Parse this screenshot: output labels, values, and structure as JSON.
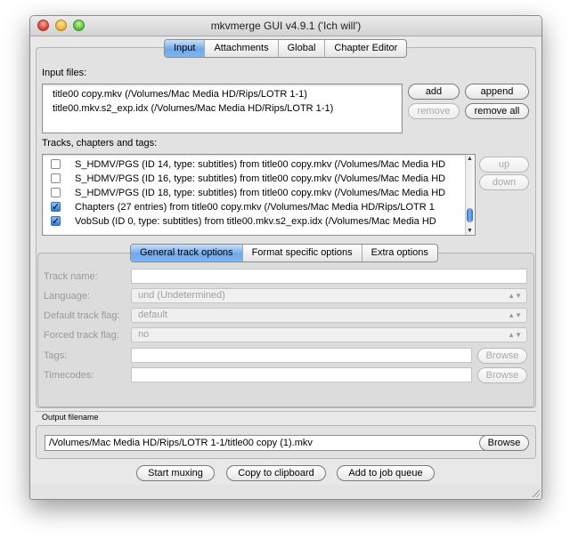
{
  "window": {
    "title": "mkvmerge GUI v4.9.1 ('Ich will')"
  },
  "main_tabs": [
    {
      "label": "Input",
      "active": true
    },
    {
      "label": "Attachments",
      "active": false
    },
    {
      "label": "Global",
      "active": false
    },
    {
      "label": "Chapter Editor",
      "active": false
    }
  ],
  "input": {
    "files_label": "Input files:",
    "files": [
      "title00 copy.mkv (/Volumes/Mac Media HD/Rips/LOTR 1-1)",
      "title00.mkv.s2_exp.idx (/Volumes/Mac Media HD/Rips/LOTR 1-1)"
    ],
    "buttons": {
      "add": "add",
      "append": "append",
      "remove": "remove",
      "remove_all": "remove all"
    }
  },
  "tracks": {
    "label": "Tracks, chapters and tags:",
    "items": [
      {
        "text": "S_HDMV/PGS (ID 14, type: subtitles) from title00 copy.mkv (/Volumes/Mac Media HD",
        "checked": false
      },
      {
        "text": "S_HDMV/PGS (ID 16, type: subtitles) from title00 copy.mkv (/Volumes/Mac Media HD",
        "checked": false
      },
      {
        "text": "S_HDMV/PGS (ID 18, type: subtitles) from title00 copy.mkv (/Volumes/Mac Media HD",
        "checked": false
      },
      {
        "text": "Chapters (27 entries) from title00 copy.mkv (/Volumes/Mac Media HD/Rips/LOTR 1",
        "checked": true
      },
      {
        "text": "VobSub (ID 0, type: subtitles) from title00.mkv.s2_exp.idx (/Volumes/Mac Media HD",
        "checked": true
      }
    ],
    "buttons": {
      "up": "up",
      "down": "down"
    }
  },
  "options_tabs": [
    {
      "label": "General track options",
      "active": true
    },
    {
      "label": "Format specific options",
      "active": false
    },
    {
      "label": "Extra options",
      "active": false
    }
  ],
  "options": {
    "track_name_label": "Track name:",
    "track_name_value": "",
    "language_label": "Language:",
    "language_value": "und (Undetermined)",
    "default_flag_label": "Default track flag:",
    "default_flag_value": "default",
    "forced_flag_label": "Forced track flag:",
    "forced_flag_value": "no",
    "tags_label": "Tags:",
    "timecodes_label": "Timecodes:",
    "browse": "Browse"
  },
  "output": {
    "label": "Output filename",
    "value": "/Volumes/Mac Media HD/Rips/LOTR 1-1/title00 copy (1).mkv",
    "browse": "Browse"
  },
  "actions": {
    "start": "Start muxing",
    "copy": "Copy to clipboard",
    "queue": "Add to job queue"
  }
}
